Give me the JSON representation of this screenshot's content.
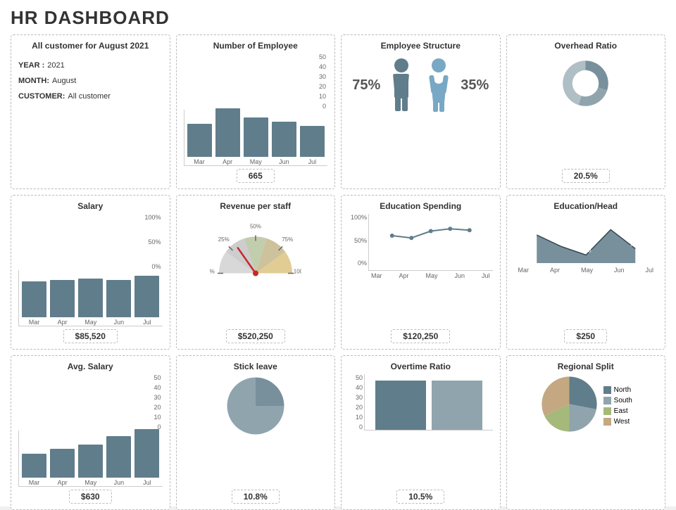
{
  "title": "HR DASHBOARD",
  "rows": [
    {
      "cards": [
        {
          "id": "all-customer",
          "title": "All customer for August 2021",
          "type": "info",
          "info": {
            "year_label": "YEAR :",
            "year_value": "2021",
            "month_label": "MONTH:",
            "month_value": "August",
            "customer_label": "CUSTOMER:",
            "customer_value": "All customer"
          },
          "value": ""
        },
        {
          "id": "num-employee",
          "title": "Number of Employee",
          "type": "bar",
          "bars": [
            {
              "label": "Mar",
              "value": 30,
              "max": 50
            },
            {
              "label": "Apr",
              "value": 44,
              "max": 50
            },
            {
              "label": "May",
              "value": 36,
              "max": 50
            },
            {
              "label": "Jun",
              "value": 32,
              "max": 50
            },
            {
              "label": "Jul",
              "value": 28,
              "max": 50
            }
          ],
          "y_labels": [
            "50",
            "40",
            "30",
            "20",
            "10",
            "0"
          ],
          "value": "665"
        },
        {
          "id": "employee-structure",
          "title": "Employee Structure",
          "type": "employee",
          "male_pct": "75%",
          "female_pct": "35%",
          "value": ""
        },
        {
          "id": "overhead-ratio",
          "title": "Overhead Ratio",
          "type": "donut",
          "value": "20.5%",
          "segments": [
            {
              "color": "#78909c",
              "pct": 30
            },
            {
              "color": "#90a4ae",
              "pct": 25
            },
            {
              "color": "#b0bec5",
              "pct": 45
            }
          ]
        }
      ]
    },
    {
      "cards": [
        {
          "id": "salary",
          "title": "Salary",
          "type": "bar",
          "bars": [
            {
              "label": "Mar",
              "value": 65,
              "max": 100
            },
            {
              "label": "Apr",
              "value": 68,
              "max": 100
            },
            {
              "label": "May",
              "value": 70,
              "max": 100
            },
            {
              "label": "Jun",
              "value": 68,
              "max": 100
            },
            {
              "label": "Jul",
              "value": 75,
              "max": 100
            }
          ],
          "y_labels": [
            "100%",
            "50%",
            "0%"
          ],
          "value": "$85,520"
        },
        {
          "id": "revenue-per-staff",
          "title": "Revenue per staff",
          "type": "gauge",
          "value": "$520,250",
          "needle_angle": 55
        },
        {
          "id": "education-spending",
          "title": "Education Spending",
          "type": "line",
          "points": [
            {
              "label": "Mar",
              "value": 60
            },
            {
              "label": "Apr",
              "value": 55
            },
            {
              "label": "May",
              "value": 70
            },
            {
              "label": "Jun",
              "value": 75
            },
            {
              "label": "Jul",
              "value": 72
            }
          ],
          "y_labels": [
            "100%",
            "50%",
            "0%"
          ],
          "value": "$120,250"
        },
        {
          "id": "education-head",
          "title": "Education/Head",
          "type": "area",
          "points": [
            {
              "label": "Mar",
              "value": 250,
              "display": "250"
            },
            {
              "label": "Apr",
              "value": 195,
              "display": "195"
            },
            {
              "label": "May",
              "value": 155,
              "display": "155"
            },
            {
              "label": "Jun",
              "value": 275,
              "display": "275"
            },
            {
              "label": "Jul",
              "value": 185,
              "display": "185"
            }
          ],
          "value": "$250"
        }
      ]
    },
    {
      "cards": [
        {
          "id": "avg-salary",
          "title": "Avg. Salary",
          "type": "bar-small",
          "bars": [
            {
              "label": "Mar",
              "value": 22,
              "max": 50
            },
            {
              "label": "Apr",
              "value": 26,
              "max": 50
            },
            {
              "label": "May",
              "value": 30,
              "max": 50
            },
            {
              "label": "Jun",
              "value": 38,
              "max": 50
            },
            {
              "label": "Jul",
              "value": 44,
              "max": 50
            }
          ],
          "y_labels": [
            "50",
            "40",
            "30",
            "20",
            "10",
            "0"
          ],
          "value": "$630"
        },
        {
          "id": "stick-leave",
          "title": "Stick leave",
          "type": "pie-simple",
          "value": "10.8%",
          "segments": [
            {
              "color": "#78909c",
              "pct": 25
            },
            {
              "color": "#90a4ae",
              "pct": 75
            }
          ]
        },
        {
          "id": "overtime-ratio",
          "title": "Overtime Ratio",
          "type": "overtime",
          "value": "10.5%",
          "bars": [
            {
              "label": "",
              "value": 45,
              "max": 50,
              "color": "#607d8b"
            },
            {
              "label": "",
              "value": 45,
              "max": 50,
              "color": "#90a4ae"
            }
          ],
          "y_labels": [
            "50",
            "40",
            "30",
            "20",
            "10",
            "0"
          ]
        },
        {
          "id": "regional-split",
          "title": "Regional Split",
          "type": "pie-legend",
          "value": "",
          "segments": [
            {
              "label": "North",
              "color": "#607d8b",
              "pct": 28
            },
            {
              "label": "South",
              "color": "#90a4ae",
              "pct": 22
            },
            {
              "label": "East",
              "color": "#a5b97a",
              "pct": 18
            },
            {
              "label": "West",
              "color": "#c4a882",
              "pct": 32
            }
          ]
        }
      ]
    }
  ]
}
